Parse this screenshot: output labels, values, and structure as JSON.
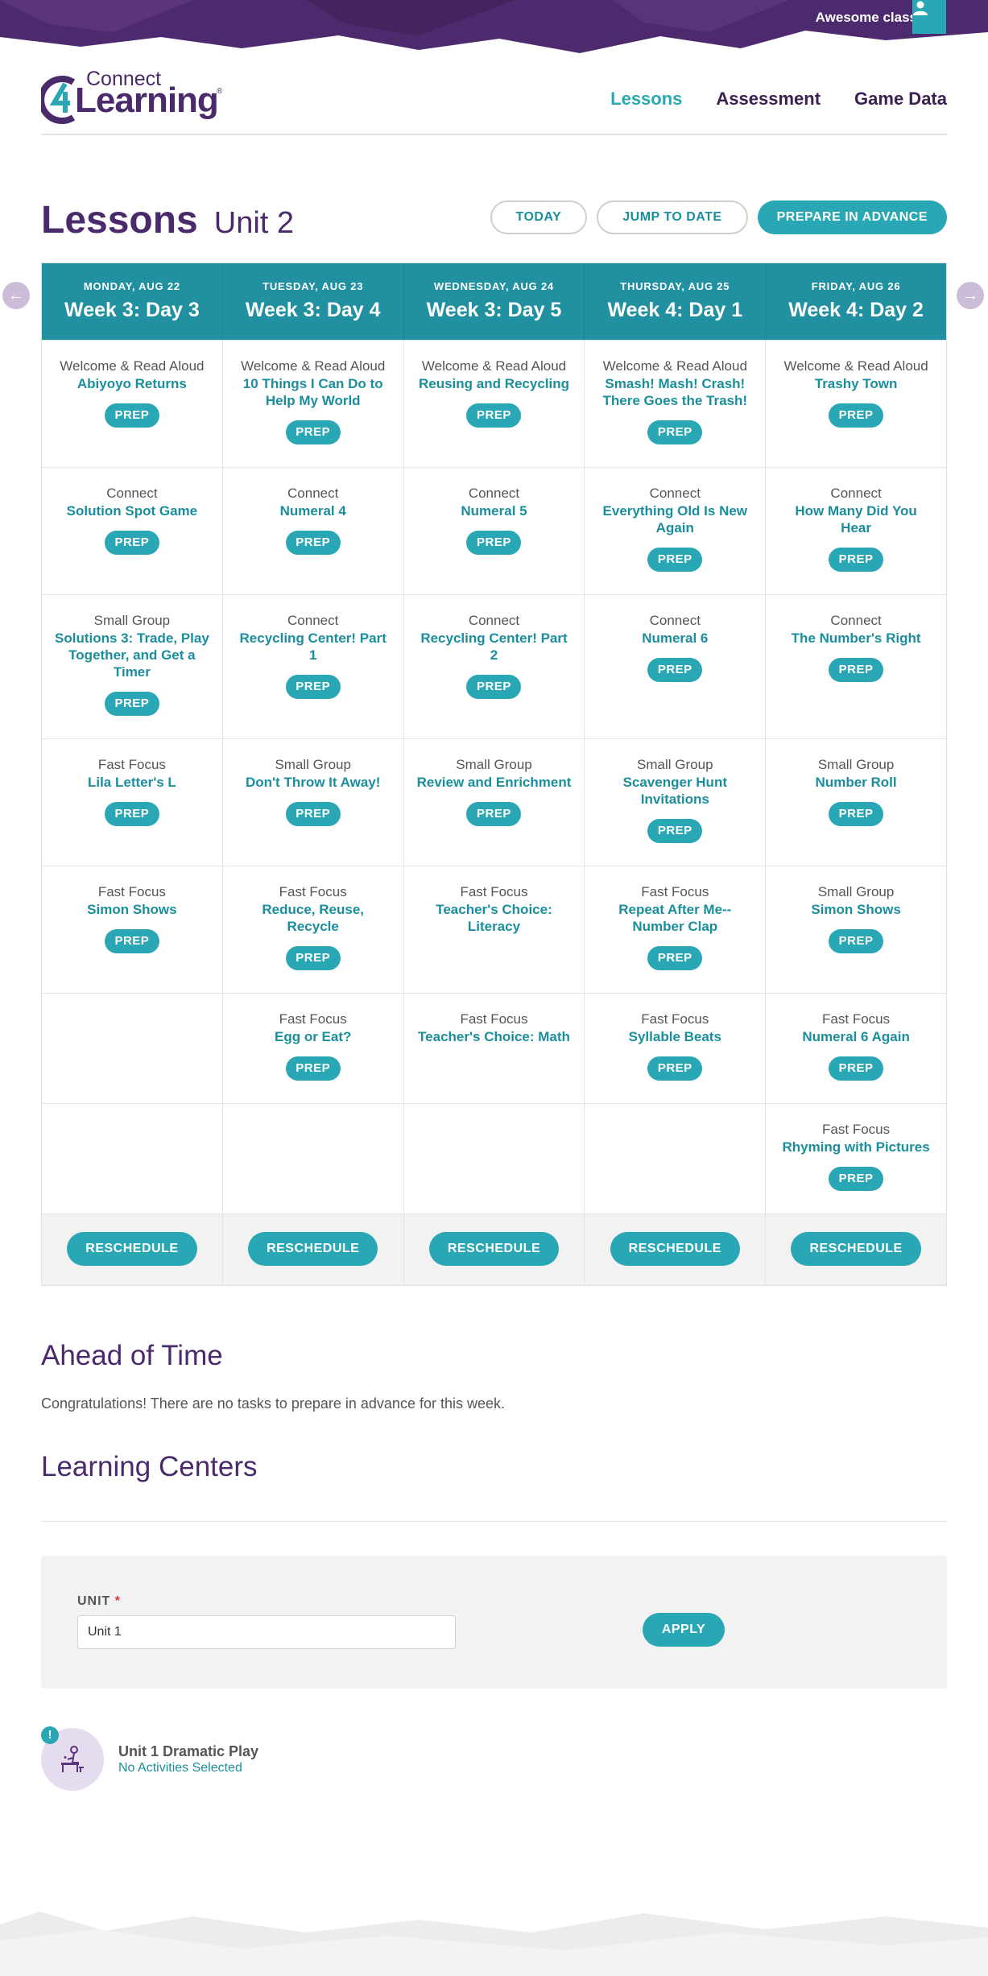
{
  "top_bar": {
    "class_name": "Awesome class",
    "user_icon": "user-icon"
  },
  "logo": {
    "connect": "Connect",
    "learning": "Learning",
    "reg": "®"
  },
  "nav": [
    {
      "label": "Lessons",
      "active": true
    },
    {
      "label": "Assessment",
      "active": false
    },
    {
      "label": "Game Data",
      "active": false
    }
  ],
  "page": {
    "title": "Lessons",
    "unit": "Unit 2"
  },
  "actions": {
    "today": "TODAY",
    "jump": "JUMP TO DATE",
    "prepare": "PREPARE IN ADVANCE"
  },
  "calendar": {
    "days": [
      {
        "date": "MONDAY, AUG 22",
        "label": "Week 3: Day 3"
      },
      {
        "date": "TUESDAY, AUG 23",
        "label": "Week 3: Day 4"
      },
      {
        "date": "WEDNESDAY, AUG 24",
        "label": "Week 3: Day 5"
      },
      {
        "date": "THURSDAY, AUG 25",
        "label": "Week 4: Day 1"
      },
      {
        "date": "FRIDAY, AUG 26",
        "label": "Week 4: Day 2"
      }
    ],
    "prep_label": "PREP",
    "reschedule_label": "RESCHEDULE",
    "rows": [
      [
        {
          "type": "Welcome & Read Aloud",
          "title": "Abiyoyo Returns"
        },
        {
          "type": "Welcome & Read Aloud",
          "title": "10 Things I Can Do to Help My World"
        },
        {
          "type": "Welcome & Read Aloud",
          "title": "Reusing and Recycling"
        },
        {
          "type": "Welcome & Read Aloud",
          "title": "Smash! Mash! Crash! There Goes the Trash!"
        },
        {
          "type": "Welcome & Read Aloud",
          "title": "Trashy Town"
        }
      ],
      [
        {
          "type": "Connect",
          "title": "Solution Spot Game"
        },
        {
          "type": "Connect",
          "title": "Numeral 4"
        },
        {
          "type": "Connect",
          "title": "Numeral 5"
        },
        {
          "type": "Connect",
          "title": "Everything Old Is New Again"
        },
        {
          "type": "Connect",
          "title": "How Many Did You Hear"
        }
      ],
      [
        {
          "type": "Small Group",
          "title": "Solutions 3: Trade, Play Together, and Get a Timer"
        },
        {
          "type": "Connect",
          "title": "Recycling Center! Part 1"
        },
        {
          "type": "Connect",
          "title": "Recycling Center! Part 2"
        },
        {
          "type": "Connect",
          "title": "Numeral 6"
        },
        {
          "type": "Connect",
          "title": "The Number's Right"
        }
      ],
      [
        {
          "type": "Fast Focus",
          "title": "Lila Letter's L"
        },
        {
          "type": "Small Group",
          "title": "Don't Throw It Away!"
        },
        {
          "type": "Small Group",
          "title": "Review and Enrichment"
        },
        {
          "type": "Small Group",
          "title": "Scavenger Hunt Invitations"
        },
        {
          "type": "Small Group",
          "title": "Number Roll"
        }
      ],
      [
        {
          "type": "Fast Focus",
          "title": "Simon Shows"
        },
        {
          "type": "Fast Focus",
          "title": "Reduce, Reuse, Recycle"
        },
        {
          "type": "Fast Focus",
          "title": "Teacher's Choice: Literacy"
        },
        {
          "type": "Fast Focus",
          "title": "Repeat After Me--Number Clap"
        },
        {
          "type": "Small Group",
          "title": "Simon Shows"
        }
      ],
      [
        null,
        {
          "type": "Fast Focus",
          "title": "Egg or Eat?"
        },
        {
          "type": "Fast Focus",
          "title": "Teacher's Choice: Math"
        },
        {
          "type": "Fast Focus",
          "title": "Syllable Beats"
        },
        {
          "type": "Fast Focus",
          "title": "Numeral 6 Again"
        }
      ],
      [
        null,
        null,
        null,
        null,
        {
          "type": "Fast Focus",
          "title": "Rhyming with Pictures"
        }
      ]
    ]
  },
  "ahead": {
    "title": "Ahead of Time",
    "text": "Congratulations! There are no tasks to prepare in advance for this week."
  },
  "centers": {
    "title": "Learning Centers",
    "unit_label": "UNIT",
    "required_mark": "*",
    "unit_value": "Unit 1",
    "apply": "APPLY",
    "items": [
      {
        "name": "Unit 1 Dramatic Play",
        "status": "No Activities Selected",
        "badge": "!"
      }
    ]
  },
  "colors": {
    "brand_purple": "#4b2a6c",
    "accent_teal": "#2aa7b4",
    "header_teal": "#2190a0"
  }
}
